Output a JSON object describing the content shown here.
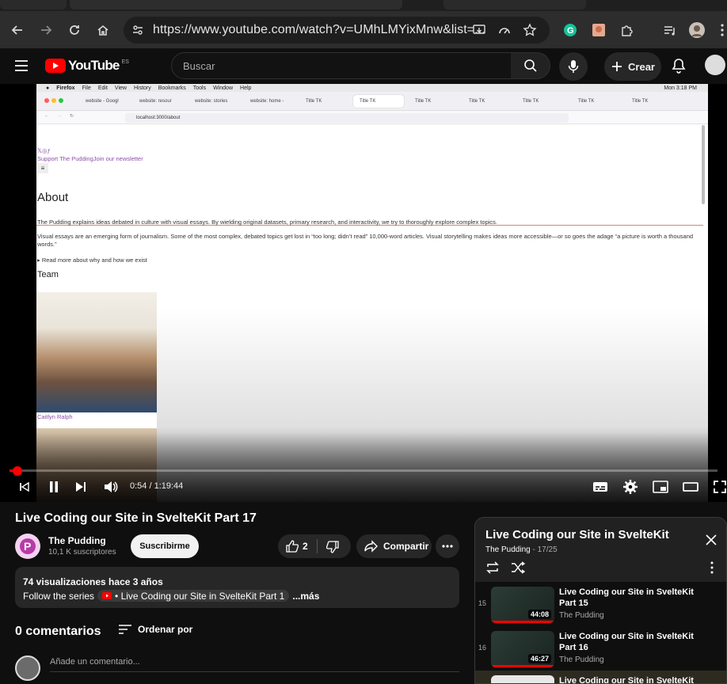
{
  "browser": {
    "url": "https://www.youtube.com/watch?v=UMhLMYixMnw&list=..."
  },
  "youtube": {
    "logo": "YouTube",
    "country": "ES",
    "search_placeholder": "Buscar",
    "create_label": "Crear"
  },
  "video_screen": {
    "mac_menu": [
      "Firefox",
      "File",
      "Edit",
      "View",
      "History",
      "Bookmarks",
      "Tools",
      "Window",
      "Help"
    ],
    "mac_clock": "Mon 3:18 PM",
    "firefox_tabs": [
      "website - Googl",
      "website: resour",
      "website: stories",
      "website: home -",
      "Title TK",
      "Title TK",
      "Title TK",
      "Title TK",
      "Title TK",
      "Title TK",
      "Title TK"
    ],
    "address": "localhost:3000/about",
    "page": {
      "nav_links": "Support The PuddingJoin our newsletter",
      "heading": "About",
      "p1": "The Pudding explains ideas debated in culture with visual essays. By wielding original datasets, primary research, and interactivity, we try to thoroughly explore complex topics.",
      "p2": "Visual essays are an emerging form of journalism. Some of the most complex, debated topics get lost in “too long; didn’t read” 10,000-word articles. Visual storytelling makes ideas more accessible—or so goes the adage “a picture is worth a thousand words.”",
      "details": "Read more about why and how we exist",
      "team_heading": "Team",
      "member_name": "Caitlyn Ralph"
    }
  },
  "player": {
    "time": "0:54 / 1:19:44",
    "progress": 0.0113
  },
  "video": {
    "title": "Live Coding our Site in SvelteKit Part 17",
    "channel": "The Pudding",
    "subscribers": "10,1 K suscriptores",
    "subscribe_label": "Suscribirme",
    "likes": "2",
    "share_label": "Compartir",
    "meta": "74 visualizaciones  hace 3 años",
    "desc_prefix": "Follow the series",
    "desc_link": "• Live Coding our Site in SvelteKit Part 1",
    "desc_more": "...más",
    "comments_count": "0 comentarios",
    "sort_label": "Ordenar por",
    "add_comment": "Añade un comentario..."
  },
  "playlist": {
    "title": "Live Coding our Site in SvelteKit",
    "channel": "The Pudding",
    "position": "17/25",
    "items": [
      {
        "index": "15",
        "title": "Live Coding our Site in SvelteKit Part 15",
        "channel": "The Pudding",
        "duration": "44:08"
      },
      {
        "index": "16",
        "title": "Live Coding our Site in SvelteKit Part 16",
        "channel": "The Pudding",
        "duration": "46:27"
      },
      {
        "index": "",
        "title": "Live Coding our Site in SvelteKit",
        "channel": "",
        "duration": ""
      }
    ]
  },
  "colors": {
    "accent": "#ff0000",
    "background": "#0f0f0f",
    "surface": "#272727",
    "link_purple": "#8b4fa8"
  }
}
